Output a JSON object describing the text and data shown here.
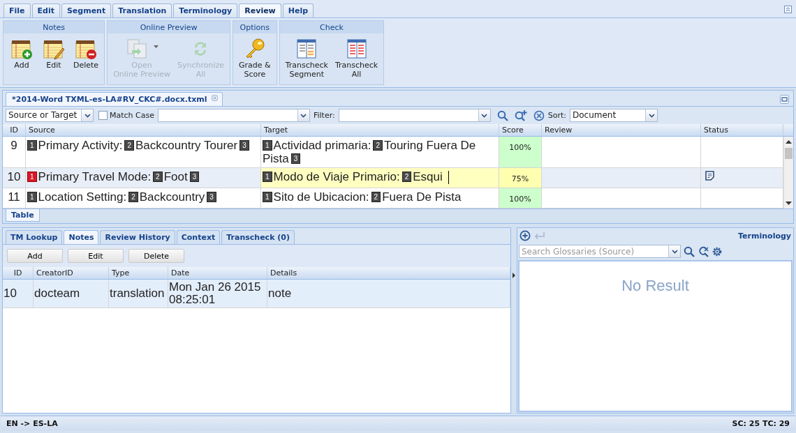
{
  "menu_tabs": [
    {
      "label": "File",
      "selected": false
    },
    {
      "label": "Edit",
      "selected": false
    },
    {
      "label": "Segment",
      "selected": false
    },
    {
      "label": "Translation",
      "selected": false
    },
    {
      "label": "Terminology",
      "selected": false
    },
    {
      "label": "Review",
      "selected": true
    },
    {
      "label": "Help",
      "selected": false
    }
  ],
  "ribbon": [
    {
      "title": "Notes",
      "buttons": [
        {
          "kind": "note-add",
          "lines": [
            "Add"
          ],
          "disabled": false,
          "dropdown": false
        },
        {
          "kind": "note-edit",
          "lines": [
            "Edit"
          ],
          "disabled": false,
          "dropdown": false
        },
        {
          "kind": "note-delete",
          "lines": [
            "Delete"
          ],
          "disabled": false,
          "dropdown": false
        }
      ]
    },
    {
      "title": "Online Preview",
      "buttons": [
        {
          "kind": "preview",
          "lines": [
            "Open",
            "Online Preview"
          ],
          "disabled": true,
          "dropdown": true
        },
        {
          "kind": "sync",
          "lines": [
            "Synchronize",
            "All"
          ],
          "disabled": true,
          "dropdown": false
        }
      ]
    },
    {
      "title": "Options",
      "buttons": [
        {
          "kind": "key",
          "lines": [
            "Grade &",
            "Score"
          ],
          "disabled": false,
          "dropdown": false
        }
      ]
    },
    {
      "title": "Check",
      "buttons": [
        {
          "kind": "transcheck-segment",
          "lines": [
            "Transcheck",
            "Segment"
          ],
          "disabled": false,
          "dropdown": false
        },
        {
          "kind": "transcheck-all",
          "lines": [
            "Transcheck",
            "All"
          ],
          "disabled": false,
          "dropdown": false
        }
      ]
    }
  ],
  "document_tab": {
    "title": "*2014-Word TXML-es-LA#RV_CKC#.docx.txml"
  },
  "search_bar": {
    "scope": "Source or Target",
    "match_case": {
      "label": "Match Case",
      "checked": false
    },
    "filter_label": "Filter:",
    "sort_label": "Sort:",
    "sort": "Document"
  },
  "segment_grid": {
    "columns": [
      "ID",
      "Source",
      "Target",
      "Score",
      "Review",
      "Status"
    ],
    "rows": [
      {
        "id": "9",
        "selected": false,
        "editing": false,
        "has_note": false,
        "score": {
          "text": "100%",
          "color": "#ccffcc"
        },
        "source": [
          {
            "kind": "tag",
            "text": "1"
          },
          {
            "kind": "text",
            "text": "Primary Activity:"
          },
          {
            "kind": "tag",
            "text": "2"
          },
          {
            "kind": "text",
            "text": "Backcountry Tourer"
          },
          {
            "kind": "tag",
            "text": "3"
          }
        ],
        "target": [
          {
            "kind": "tag",
            "text": "1"
          },
          {
            "kind": "text",
            "text": "Actividad primaria:"
          },
          {
            "kind": "tag",
            "text": "2"
          },
          {
            "kind": "text",
            "text": "Touring Fuera De Pista"
          },
          {
            "kind": "tag",
            "text": "3"
          }
        ]
      },
      {
        "id": "10",
        "selected": true,
        "editing": true,
        "has_note": true,
        "score": {
          "text": "75%",
          "color": "#ffffb0"
        },
        "source": [
          {
            "kind": "error-tag",
            "text": "1"
          },
          {
            "kind": "text",
            "text": "Primary Travel Mode:"
          },
          {
            "kind": "tag",
            "text": "2"
          },
          {
            "kind": "text",
            "text": "Foot"
          },
          {
            "kind": "tag",
            "text": "3"
          }
        ],
        "target": [
          {
            "kind": "tag",
            "text": "1"
          },
          {
            "kind": "text",
            "text": "Modo de Viaje Primario:"
          },
          {
            "kind": "tag",
            "text": "2"
          },
          {
            "kind": "text",
            "text": "Esqui"
          }
        ]
      },
      {
        "id": "11",
        "selected": false,
        "editing": false,
        "has_note": false,
        "score": {
          "text": "100%",
          "color": "#ccffcc"
        },
        "source": [
          {
            "kind": "tag",
            "text": "1"
          },
          {
            "kind": "text",
            "text": "Location Setting:"
          },
          {
            "kind": "tag",
            "text": "2"
          },
          {
            "kind": "text",
            "text": "Backcountry"
          },
          {
            "kind": "tag",
            "text": "3"
          }
        ],
        "target": [
          {
            "kind": "tag",
            "text": "1"
          },
          {
            "kind": "text",
            "text": "Sito de Ubicacion:"
          },
          {
            "kind": "tag",
            "text": "2"
          },
          {
            "kind": "text",
            "text": "Fuera De Pista"
          }
        ]
      }
    ]
  },
  "view_tabs": [
    {
      "label": "Table",
      "selected": true
    }
  ],
  "bottom_tabs": [
    {
      "label": "TM Lookup",
      "selected": false
    },
    {
      "label": "Notes",
      "selected": true
    },
    {
      "label": "Review History",
      "selected": false
    },
    {
      "label": "Context",
      "selected": false
    },
    {
      "label": "Transcheck (0)",
      "selected": false
    }
  ],
  "notes_buttons": [
    "Add",
    "Edit",
    "Delete"
  ],
  "notes_grid": {
    "columns": [
      "ID",
      "CreatorID",
      "Type",
      "Date",
      "Details"
    ],
    "rows": [
      {
        "selected": true,
        "cells": [
          "10",
          "docteam",
          "translation",
          "Mon Jan 26 2015 08:25:01",
          "note"
        ]
      }
    ]
  },
  "terminology": {
    "title": "Terminology",
    "search": {
      "placeholder": "Search Glossaries (Source)"
    },
    "empty_message": "No Result"
  },
  "status_bar": {
    "language_pair": "EN -> ES-LA",
    "counts": "SC: 25 TC: 29"
  }
}
